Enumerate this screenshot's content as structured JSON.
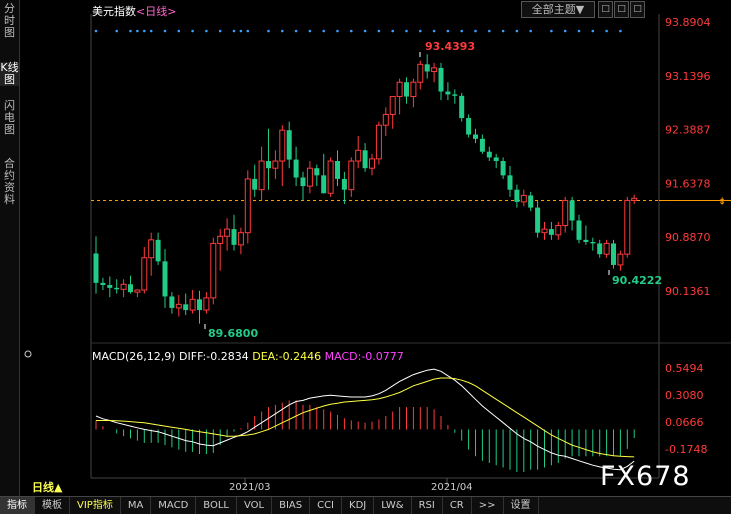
{
  "side_tabs": [
    {
      "label": "分时图",
      "active": false
    },
    {
      "label": "K线图",
      "active": true
    },
    {
      "label": "闪电图",
      "active": false
    },
    {
      "label": "合约资料",
      "active": false
    }
  ],
  "header": {
    "title": "美元指数",
    "period": "<日线>",
    "theme_label": "全部主题",
    "tool_buttons": [
      "□",
      "□",
      "□"
    ]
  },
  "macd_legend": {
    "name": "MACD(26,12,9)",
    "diff": "DIFF:-0.2834",
    "dea": "DEA:-0.2446",
    "macd": "MACD:-0.0777"
  },
  "bottom_period": "日线▲",
  "bottom_tabs": [
    {
      "label": "指标",
      "active": true
    },
    {
      "label": "模板",
      "active": false
    },
    {
      "label": "VIP指标",
      "active": false,
      "vip": true
    },
    {
      "label": "MA",
      "active": false
    },
    {
      "label": "MACD",
      "active": false
    },
    {
      "label": "BOLL",
      "active": false
    },
    {
      "label": "VOL",
      "active": false
    },
    {
      "label": "BIAS",
      "active": false
    },
    {
      "label": "CCI",
      "active": false
    },
    {
      "label": "KDJ",
      "active": false
    },
    {
      "label": "LW&",
      "active": false
    },
    {
      "label": "RSI",
      "active": false
    },
    {
      "label": "CR",
      "active": false
    },
    {
      "label": ">>",
      "active": false
    },
    {
      "label": "设置",
      "active": false
    }
  ],
  "watermark": "FX678",
  "colors": {
    "up": "#ff3b3b",
    "down": "#22cc88",
    "diff_line": "#ffffff",
    "dea_line": "#ffff44",
    "macd_label": "#ff44ff",
    "axis_label": "#ff3b3b",
    "dashed": "#ff9900"
  },
  "chart_data": {
    "type": "candlestick",
    "price_axis": {
      "ticks": [
        93.8904,
        93.1396,
        92.3887,
        91.6378,
        90.887,
        90.1361
      ],
      "tick_labels": [
        "93.8904",
        "93.1396",
        "92.3887",
        "91.6378",
        "90.8870",
        "90.1361"
      ],
      "range": [
        89.4,
        94.0
      ]
    },
    "date_labels": [
      "2021/03",
      "2021/04"
    ],
    "annotations": {
      "high": "93.4393",
      "low": "89.6800",
      "last_low": "90.4222"
    },
    "current_price": 91.4,
    "candles": [
      [
        90.66,
        90.9,
        90.1,
        90.25
      ],
      [
        90.25,
        90.32,
        90.15,
        90.22
      ],
      [
        90.22,
        90.34,
        90.05,
        90.18
      ],
      [
        90.18,
        90.3,
        90.1,
        90.16
      ],
      [
        90.16,
        90.3,
        90.05,
        90.23
      ],
      [
        90.23,
        90.35,
        90.1,
        90.12
      ],
      [
        90.12,
        90.16,
        90.05,
        90.15
      ],
      [
        90.15,
        90.75,
        90.1,
        90.6
      ],
      [
        90.6,
        90.95,
        90.35,
        90.85
      ],
      [
        90.85,
        90.95,
        90.5,
        90.55
      ],
      [
        90.55,
        90.72,
        89.9,
        90.06
      ],
      [
        90.06,
        90.12,
        89.82,
        89.9
      ],
      [
        89.9,
        90.08,
        89.78,
        89.95
      ],
      [
        89.95,
        90.1,
        89.8,
        89.87
      ],
      [
        89.87,
        90.15,
        89.82,
        90.02
      ],
      [
        90.02,
        90.14,
        89.68,
        89.87
      ],
      [
        89.87,
        90.12,
        89.82,
        90.04
      ],
      [
        90.04,
        90.88,
        89.95,
        90.8
      ],
      [
        90.8,
        91.0,
        90.42,
        90.9
      ],
      [
        90.9,
        91.15,
        90.7,
        91.0
      ],
      [
        91.0,
        91.2,
        90.7,
        90.78
      ],
      [
        90.78,
        91.02,
        90.65,
        90.95
      ],
      [
        90.95,
        91.82,
        90.8,
        91.7
      ],
      [
        91.7,
        91.9,
        91.45,
        91.55
      ],
      [
        91.55,
        92.15,
        91.4,
        91.95
      ],
      [
        91.95,
        92.4,
        91.55,
        91.85
      ],
      [
        91.85,
        92.1,
        91.7,
        91.95
      ],
      [
        91.95,
        92.45,
        91.6,
        92.38
      ],
      [
        92.38,
        92.5,
        91.85,
        91.97
      ],
      [
        91.97,
        92.15,
        91.6,
        91.72
      ],
      [
        91.72,
        91.8,
        91.4,
        91.6
      ],
      [
        91.6,
        91.95,
        91.5,
        91.85
      ],
      [
        91.85,
        91.9,
        91.6,
        91.75
      ],
      [
        91.75,
        92.05,
        91.5,
        91.5
      ],
      [
        91.5,
        92.0,
        91.45,
        91.95
      ],
      [
        91.95,
        92.1,
        91.6,
        91.7
      ],
      [
        91.7,
        91.8,
        91.35,
        91.55
      ],
      [
        91.55,
        92.0,
        91.45,
        91.95
      ],
      [
        91.95,
        92.3,
        91.85,
        92.1
      ],
      [
        92.1,
        92.2,
        91.8,
        91.85
      ],
      [
        91.85,
        92.05,
        91.75,
        91.98
      ],
      [
        91.98,
        92.5,
        91.9,
        92.45
      ],
      [
        92.45,
        92.7,
        92.3,
        92.6
      ],
      [
        92.6,
        92.8,
        92.4,
        92.85
      ],
      [
        92.85,
        93.1,
        92.6,
        93.05
      ],
      [
        93.05,
        93.12,
        92.75,
        92.85
      ],
      [
        92.85,
        93.1,
        92.7,
        93.05
      ],
      [
        93.05,
        93.35,
        92.95,
        93.3
      ],
      [
        93.3,
        93.44,
        93.1,
        93.2
      ],
      [
        93.2,
        93.32,
        93.05,
        93.25
      ],
      [
        93.25,
        93.32,
        92.8,
        92.92
      ],
      [
        92.92,
        93.05,
        92.8,
        92.88
      ],
      [
        92.88,
        92.95,
        92.75,
        92.86
      ],
      [
        92.86,
        92.9,
        92.5,
        92.55
      ],
      [
        92.55,
        92.6,
        92.28,
        92.32
      ],
      [
        92.32,
        92.4,
        92.2,
        92.26
      ],
      [
        92.26,
        92.32,
        92.05,
        92.08
      ],
      [
        92.08,
        92.15,
        91.95,
        92.0
      ],
      [
        92.0,
        92.05,
        91.85,
        91.95
      ],
      [
        91.95,
        92.0,
        91.7,
        91.75
      ],
      [
        91.75,
        91.88,
        91.45,
        91.55
      ],
      [
        91.55,
        91.62,
        91.3,
        91.38
      ],
      [
        91.38,
        91.55,
        91.32,
        91.47
      ],
      [
        91.47,
        91.52,
        91.25,
        91.3
      ],
      [
        91.3,
        91.4,
        90.88,
        90.95
      ],
      [
        90.95,
        91.1,
        90.85,
        91.0
      ],
      [
        91.0,
        91.1,
        90.85,
        90.92
      ],
      [
        90.92,
        91.1,
        90.85,
        91.05
      ],
      [
        91.05,
        91.45,
        90.95,
        91.4
      ],
      [
        91.4,
        91.45,
        90.98,
        91.12
      ],
      [
        91.12,
        91.2,
        90.8,
        90.85
      ],
      [
        90.85,
        91.05,
        90.78,
        90.82
      ],
      [
        90.82,
        90.88,
        90.7,
        90.8
      ],
      [
        90.8,
        90.85,
        90.6,
        90.65
      ],
      [
        90.65,
        90.85,
        90.6,
        90.8
      ],
      [
        90.8,
        90.85,
        90.45,
        90.5
      ],
      [
        90.5,
        90.7,
        90.42,
        90.65
      ],
      [
        90.65,
        91.45,
        90.6,
        91.4
      ],
      [
        91.4,
        91.48,
        91.35,
        91.43
      ]
    ],
    "macd_axis": {
      "ticks": [
        0.5494,
        0.308,
        0.0666,
        -0.1748
      ],
      "tick_labels": [
        "0.5494",
        "0.3080",
        "0.0666",
        "-0.1748"
      ],
      "range": [
        -0.42,
        0.64
      ]
    },
    "macd_series": [
      {
        "name": "DIFF",
        "values": [
          0.12,
          0.095,
          0.08,
          0.06,
          0.045,
          0.03,
          0.015,
          0.0,
          -0.01,
          -0.02,
          -0.04,
          -0.06,
          -0.08,
          -0.1,
          -0.11,
          -0.13,
          -0.14,
          -0.145,
          -0.12,
          -0.095,
          -0.07,
          -0.05,
          -0.02,
          0.02,
          0.06,
          0.1,
          0.14,
          0.18,
          0.22,
          0.25,
          0.26,
          0.28,
          0.29,
          0.3,
          0.305,
          0.3,
          0.295,
          0.29,
          0.29,
          0.29,
          0.3,
          0.32,
          0.35,
          0.39,
          0.43,
          0.46,
          0.49,
          0.51,
          0.53,
          0.54,
          0.52,
          0.48,
          0.44,
          0.39,
          0.33,
          0.27,
          0.21,
          0.16,
          0.11,
          0.06,
          0.01,
          -0.04,
          -0.08,
          -0.11,
          -0.15,
          -0.18,
          -0.21,
          -0.23,
          -0.24,
          -0.26,
          -0.28,
          -0.3,
          -0.32,
          -0.335,
          -0.345,
          -0.355,
          -0.36,
          -0.33,
          -0.283
        ]
      },
      {
        "name": "DEA",
        "values": [
          0.08,
          0.08,
          0.08,
          0.078,
          0.075,
          0.07,
          0.065,
          0.06,
          0.05,
          0.04,
          0.03,
          0.02,
          0.01,
          0.0,
          -0.01,
          -0.02,
          -0.03,
          -0.04,
          -0.05,
          -0.06,
          -0.06,
          -0.055,
          -0.05,
          -0.04,
          -0.02,
          0.0,
          0.03,
          0.06,
          0.09,
          0.12,
          0.15,
          0.17,
          0.19,
          0.21,
          0.225,
          0.235,
          0.245,
          0.25,
          0.255,
          0.26,
          0.265,
          0.275,
          0.29,
          0.31,
          0.33,
          0.36,
          0.39,
          0.41,
          0.43,
          0.45,
          0.46,
          0.46,
          0.455,
          0.44,
          0.42,
          0.39,
          0.35,
          0.31,
          0.27,
          0.23,
          0.19,
          0.15,
          0.11,
          0.07,
          0.03,
          -0.01,
          -0.05,
          -0.08,
          -0.11,
          -0.14,
          -0.16,
          -0.18,
          -0.2,
          -0.215,
          -0.225,
          -0.235,
          -0.24,
          -0.243,
          -0.245
        ]
      }
    ]
  }
}
